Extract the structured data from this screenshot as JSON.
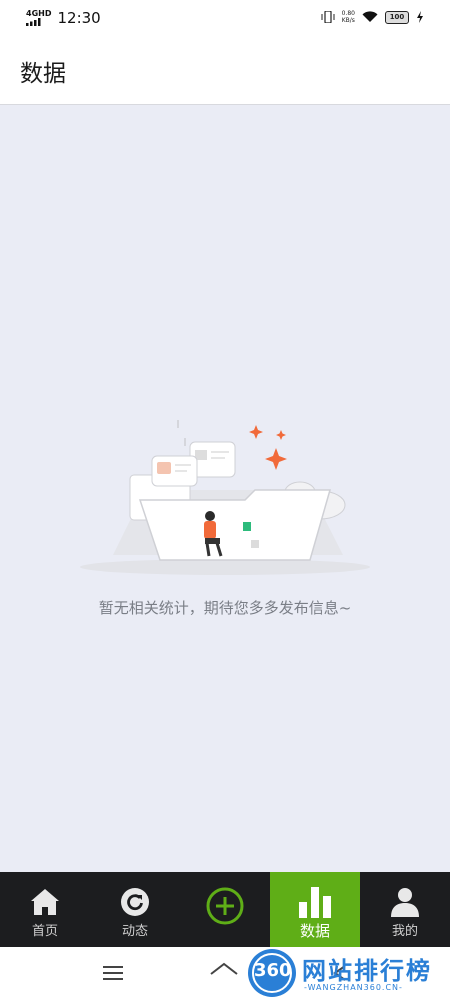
{
  "status_bar": {
    "network": "4G",
    "network_hd": "HD",
    "time": "12:30",
    "speed_value": "0.80",
    "speed_unit": "KB/s",
    "battery": "100"
  },
  "header": {
    "title": "数据"
  },
  "empty_state": {
    "message": "暂无相关统计，期待您多多发布信息~"
  },
  "bottom_nav": {
    "items": [
      {
        "label": "首页",
        "icon": "home-icon",
        "active": false
      },
      {
        "label": "动态",
        "icon": "refresh-icon",
        "active": false
      },
      {
        "label": "",
        "icon": "add-circle-icon",
        "active": false
      },
      {
        "label": "数据",
        "icon": "bar-chart-icon",
        "active": true
      },
      {
        "label": "我的",
        "icon": "person-icon",
        "active": false
      }
    ],
    "active_color": "#5fae17"
  },
  "system_nav": {
    "icons": [
      "menu-icon",
      "home-icon",
      "back-icon"
    ]
  },
  "watermark": {
    "logo": "360",
    "text": "网站排行榜",
    "sub": "-WANGZHAN360.CN-"
  }
}
